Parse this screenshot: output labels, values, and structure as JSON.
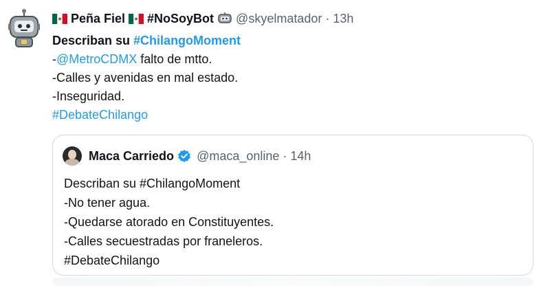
{
  "tweet": {
    "author_name": "Peña Fiel",
    "author_hashtag": "#NoSoyBot",
    "author_handle": "@skyelmatador",
    "separator": "·",
    "time": "13h",
    "lines": {
      "l1_prefix": "Describan su ",
      "l1_hashtag": "#ChilangoMoment",
      "l2_dash": "-",
      "l2_mention": "@MetroCDMX",
      "l2_rest": " falto de mtto.",
      "l3": "-Calles y avenidas en mal estado.",
      "l4": "-Inseguridad.",
      "l5_hashtag": "#DebateChilango"
    },
    "icons": {
      "avatar": "robot-avatar-icon",
      "flag": "mexico-flag-icon",
      "bot": "robot-icon"
    }
  },
  "quoted": {
    "author_name": "Maca Carriedo",
    "author_handle": "@maca_online",
    "separator": "·",
    "time": "14h",
    "lines": [
      "Describan su #ChilangoMoment",
      "-No tener agua.",
      "-Quedarse atorado en Constituyentes.",
      "-Calles secuestradas por franeleros.",
      "#DebateChilango"
    ],
    "icons": {
      "verified": "verified-badge-icon"
    }
  },
  "colors": {
    "link": "#1d9bf0",
    "muted": "#536471",
    "border": "#cfd9de",
    "flag_green": "#006847",
    "flag_red": "#ce1126"
  }
}
